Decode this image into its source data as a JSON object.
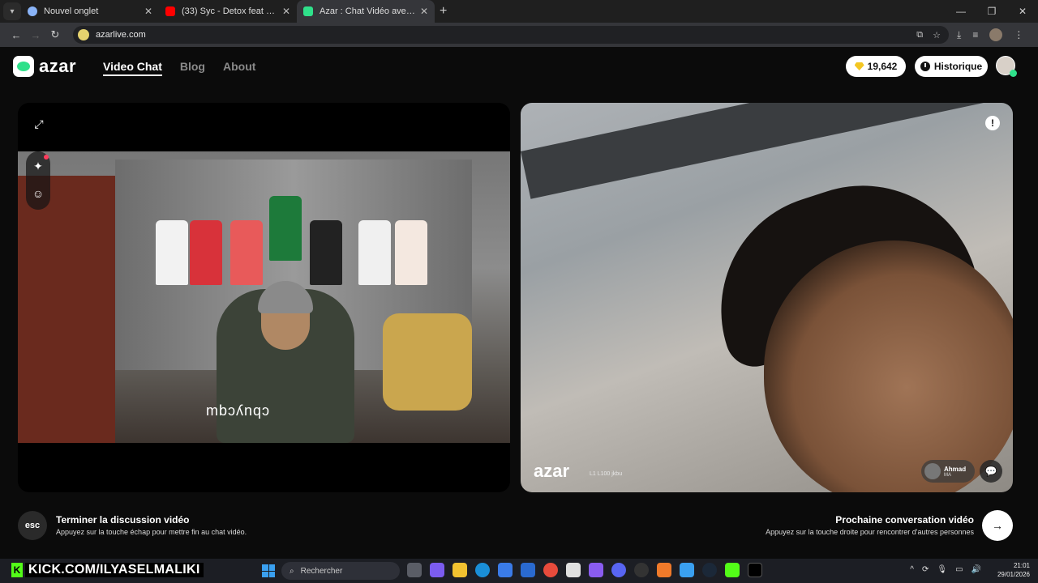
{
  "browser": {
    "tabs": [
      {
        "title": "Nouvel onglet",
        "active": false
      },
      {
        "title": "(33) Syc - Detox feat @Alterego",
        "active": false
      },
      {
        "title": "Azar : Chat Vidéo avec de n",
        "active": true
      }
    ],
    "url": "azarlive.com"
  },
  "app": {
    "logo": "azar",
    "nav": [
      "Video Chat",
      "Blog",
      "About"
    ],
    "gems": "19,642",
    "history_label": "Historique"
  },
  "remote": {
    "watermark": "azar",
    "id_text": "L1 L100 jkbu",
    "peer_name": "Ahmad",
    "peer_country": "MA"
  },
  "local": {
    "watermark": "mbɔʎnqɔ"
  },
  "actions": {
    "esc_key": "esc",
    "end_title": "Terminer la discussion vidéo",
    "end_hint": "Appuyez sur la touche échap pour mettre fin au chat vidéo.",
    "next_title": "Prochaine conversation vidéo",
    "next_hint": "Appuyez sur la touche droite pour rencontrer d'autres personnes",
    "next_symbol": "→"
  },
  "taskbar": {
    "overlay": "KICK.COM/ILYASELMALIKI",
    "search_placeholder": "Rechercher",
    "time": "21:01",
    "date": "29/01/2026"
  },
  "colors": {
    "accent": "#2fe08a",
    "kick": "#53fc18",
    "notif": "#ff3b5c"
  }
}
